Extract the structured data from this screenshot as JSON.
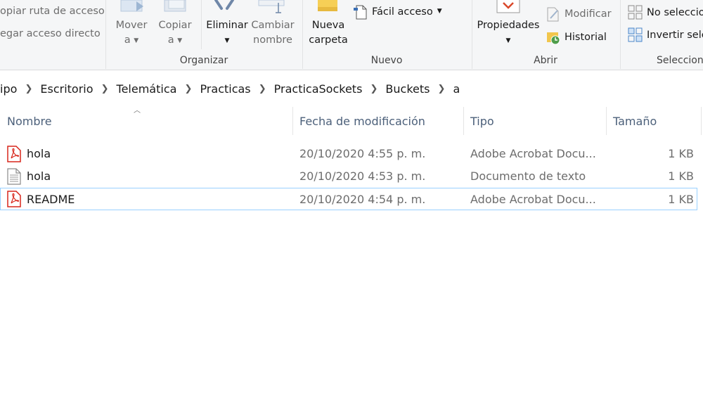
{
  "ribbon": {
    "portapapeles": {
      "copy_path": "opiar ruta de acceso",
      "paste_shortcut": "egar acceso directo"
    },
    "organizar": {
      "group_label": "Organizar",
      "move_to_line1": "Mover",
      "move_to_line2": "a",
      "copy_to_line1": "Copiar",
      "copy_to_line2": "a",
      "delete": "Eliminar",
      "rename_line1": "Cambiar",
      "rename_line2": "nombre"
    },
    "nuevo": {
      "group_label": "Nuevo",
      "new_folder_line1": "Nueva",
      "new_folder_line2": "carpeta",
      "easy_access": "Fácil acceso"
    },
    "abrir": {
      "group_label": "Abrir",
      "properties": "Propiedades",
      "edit": "Modificar",
      "history": "Historial"
    },
    "seleccionar": {
      "group_label": "Seleccion",
      "select_none": "No seleccio",
      "invert_selection": "Invertir sele"
    }
  },
  "breadcrumb": [
    "ipo",
    "Escritorio",
    "Telemática",
    "Practicas",
    "PracticaSockets",
    "Buckets",
    "a"
  ],
  "columns": {
    "name": "Nombre",
    "modified": "Fecha de modificación",
    "type": "Tipo",
    "size": "Tamaño"
  },
  "files": [
    {
      "name": "hola",
      "modified": "20/10/2020 4:55 p. m.",
      "type": "Adobe Acrobat Docu...",
      "size": "1 KB",
      "icon": "pdf-icon"
    },
    {
      "name": "hola",
      "modified": "20/10/2020 4:53 p. m.",
      "type": "Documento de texto",
      "size": "1 KB",
      "icon": "text-file-icon"
    },
    {
      "name": "README",
      "modified": "20/10/2020 4:54 p. m.",
      "type": "Adobe Acrobat Docu...",
      "size": "1 KB",
      "icon": "pdf-icon"
    }
  ],
  "colors": {
    "ribbon_bg": "#f5f6f7",
    "header_text": "#4c607a",
    "selection_border": "#99d1ff",
    "pdf_red": "#d8261c"
  }
}
